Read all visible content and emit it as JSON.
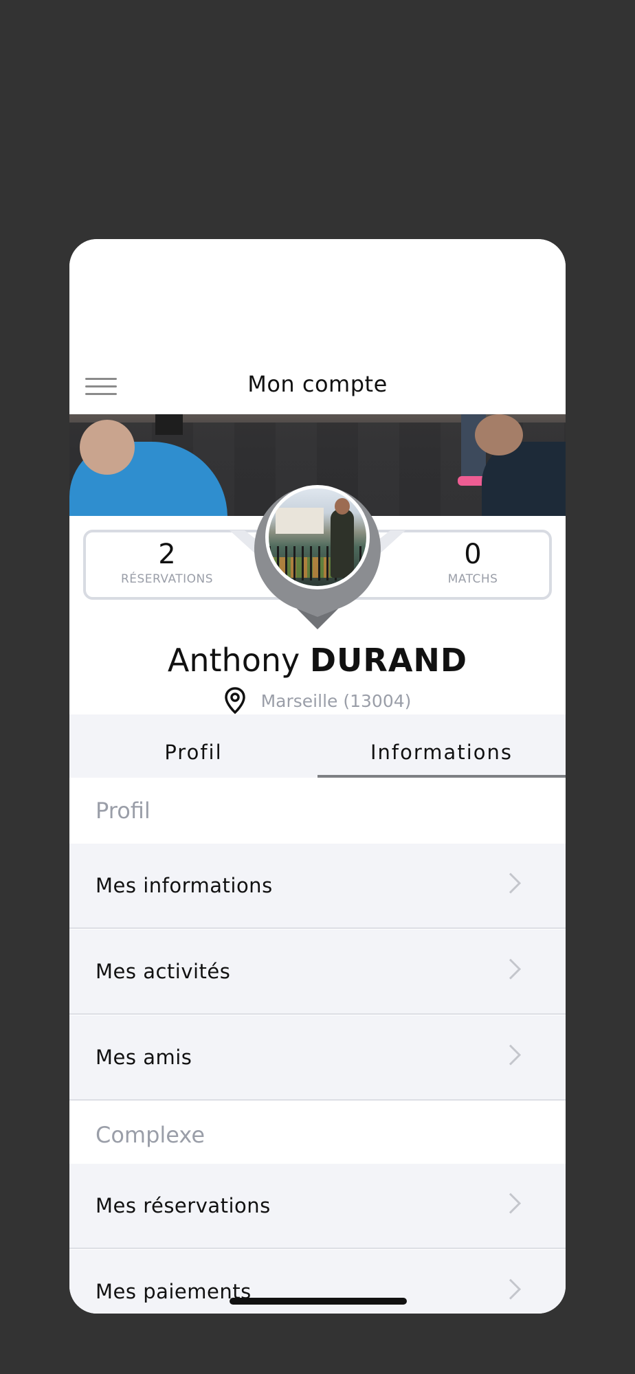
{
  "header": {
    "title": "Mon compte",
    "menu_icon": "hamburger-menu-icon"
  },
  "stats": {
    "reservations": {
      "value": "2",
      "label": "RÉSERVATIONS"
    },
    "matchs": {
      "value": "0",
      "label": "MATCHS"
    }
  },
  "user": {
    "first_name": "Anthony",
    "last_name": "DURAND",
    "location": "Marseille (13004)"
  },
  "tabs": [
    {
      "label": "Profil",
      "active": false
    },
    {
      "label": "Informations",
      "active": true
    }
  ],
  "sections": [
    {
      "title": "Profil",
      "items": [
        "Mes informations",
        "Mes activités",
        "Mes amis"
      ]
    },
    {
      "title": "Complexe",
      "items": [
        "Mes réservations",
        "Mes paiements"
      ]
    }
  ],
  "colors": {
    "background": "#333333",
    "list_bg": "#f3f4f8",
    "muted_text": "#9a9ea8",
    "tab_indicator": "#7d7f83"
  }
}
